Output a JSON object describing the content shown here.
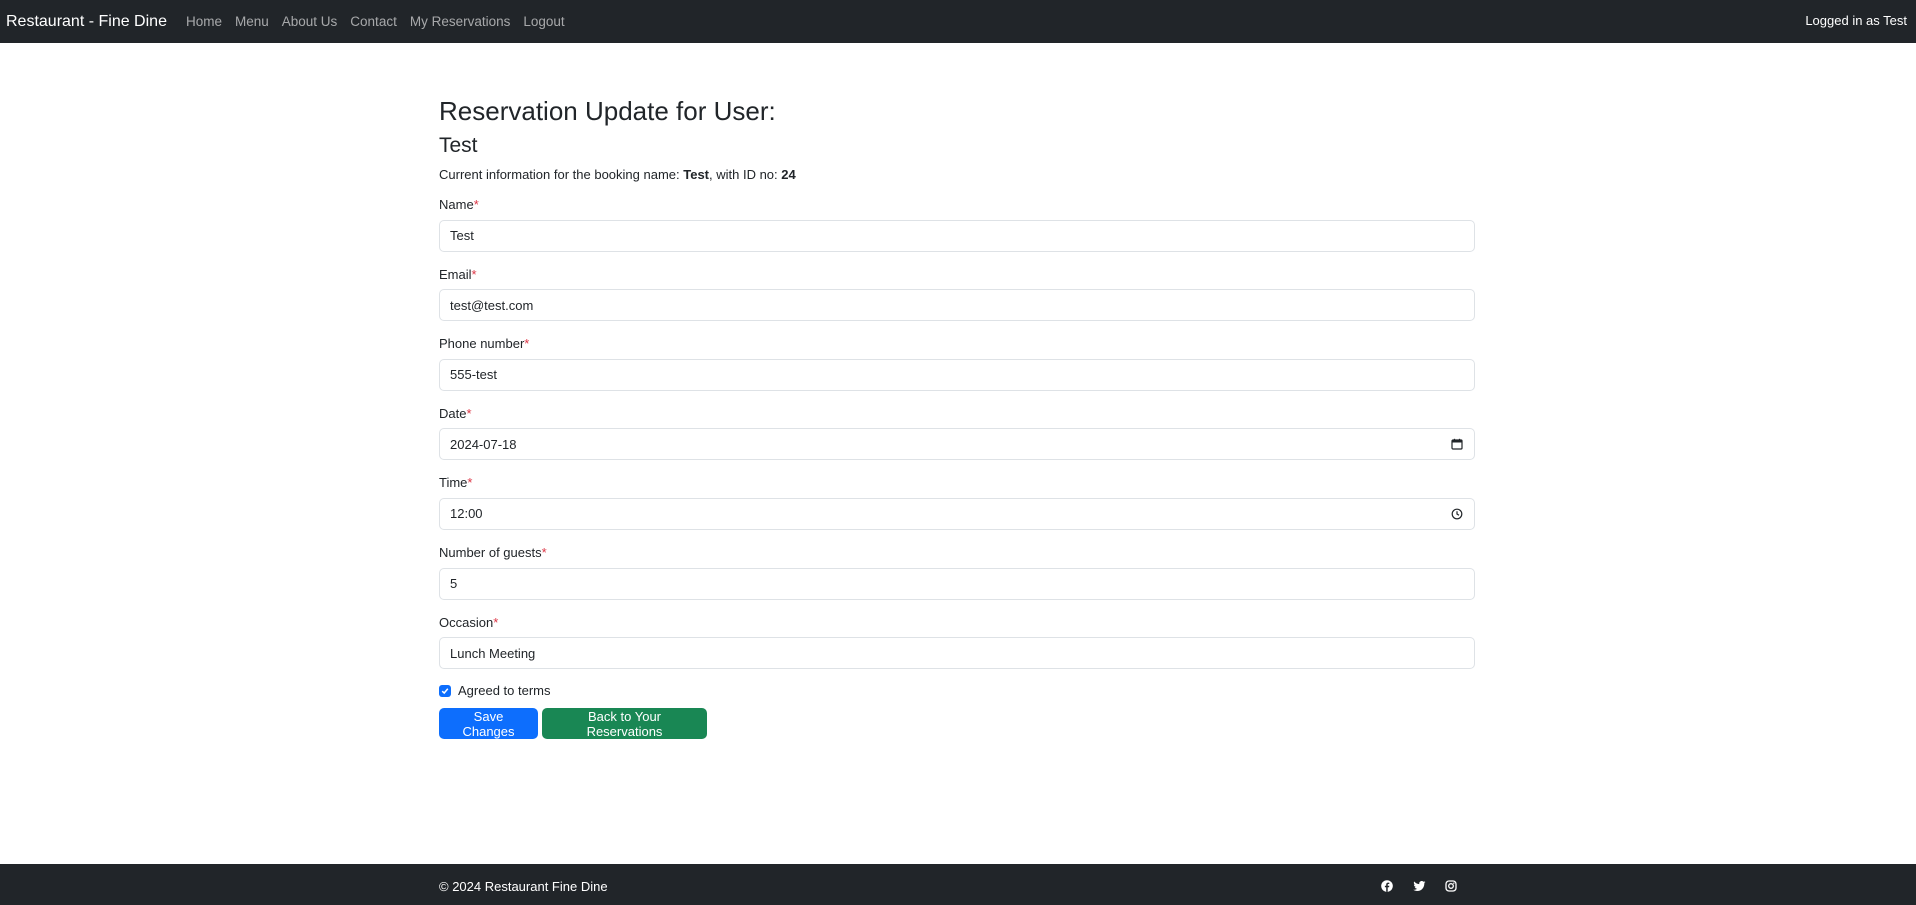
{
  "navbar": {
    "brand": "Restaurant - Fine Dine",
    "links": [
      "Home",
      "Menu",
      "About Us",
      "Contact",
      "My Reservations",
      "Logout"
    ],
    "status": "Logged in as Test"
  },
  "page": {
    "title": "Reservation Update for User:",
    "subtitle": "Test",
    "info_prefix": "Current information for the booking name: ",
    "info_name": "Test",
    "info_mid": ", with ID no: ",
    "info_id": "24"
  },
  "form": {
    "required_mark": "*",
    "fields": [
      {
        "label": "Name",
        "value": "Test"
      },
      {
        "label": "Email",
        "value": "test@test.com"
      },
      {
        "label": "Phone number",
        "value": "555-test"
      },
      {
        "label": "Date",
        "value": "2024-07-18",
        "icon": "calendar-icon"
      },
      {
        "label": "Time",
        "value": "12:00",
        "icon": "clock-icon"
      },
      {
        "label": "Number of guests",
        "value": "5"
      },
      {
        "label": "Occasion",
        "value": "Lunch Meeting"
      }
    ],
    "terms_label": "Agreed to terms",
    "terms_checked": true
  },
  "buttons": {
    "save": "Save Changes",
    "back": "Back to Your Reservations"
  },
  "footer": {
    "copyright": "© 2024 Restaurant Fine Dine",
    "social_icons": [
      "facebook-icon",
      "twitter-icon",
      "instagram-icon"
    ]
  },
  "colors": {
    "navbar_bg": "#212529",
    "primary": "#0d6efd",
    "success": "#198754",
    "required": "#dc3545"
  }
}
